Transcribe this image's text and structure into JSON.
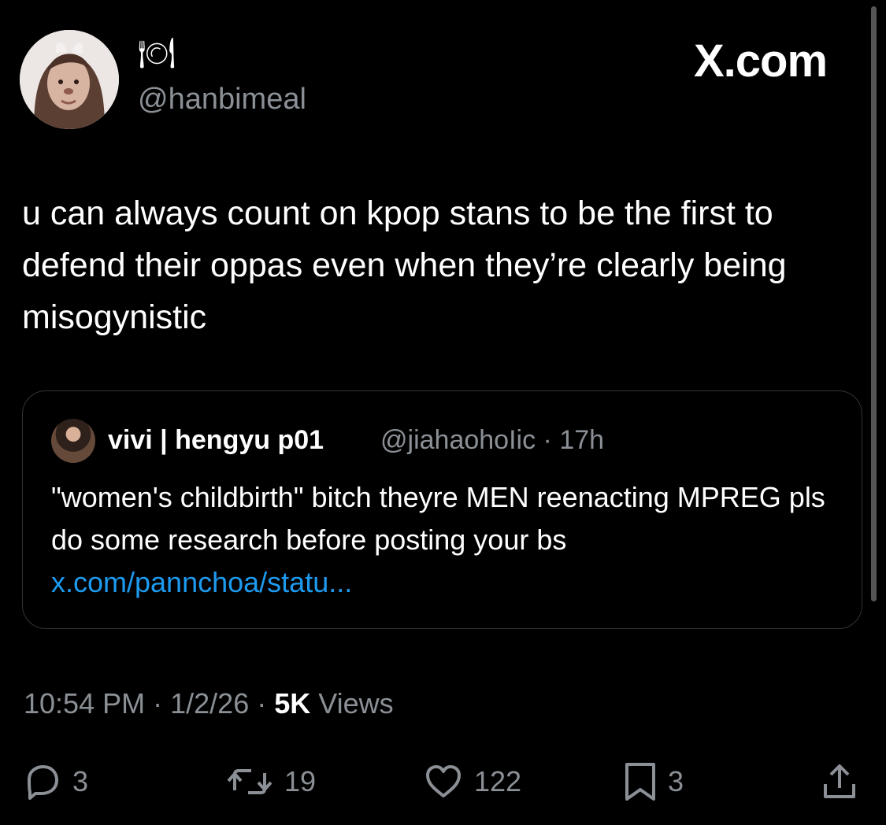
{
  "author": {
    "display_name": "🍽",
    "handle": "@hanbimeal",
    "avatar_icon": "profile-photo"
  },
  "brand": {
    "label": "X.com"
  },
  "tweet": {
    "text": "u can always count on kpop stans to be the first to defend their oppas even when they’re clearly being misogynistic",
    "time": "10:54 PM",
    "sep1": "·",
    "date": "1/2/26",
    "sep2": "·",
    "views_count": "5K",
    "views_label": "Views"
  },
  "quoted": {
    "name": "vivi | hengyu p01",
    "handle": "@jiahaohoIic",
    "separator": "·",
    "time": "17h",
    "text": "\"women's childbirth\" bitch theyre MEN reenacting MPREG pls do some research before posting your bs",
    "link": "x.com/pannchoa/statu..."
  },
  "actions": {
    "reply_count": "3",
    "repost_count": "19",
    "like_count": "122",
    "bookmark_count": "3"
  },
  "colors": {
    "background": "#000000",
    "text": "#e7e9ea",
    "muted": "#8b9096",
    "link": "#1d9bf0",
    "border": "#333333"
  }
}
